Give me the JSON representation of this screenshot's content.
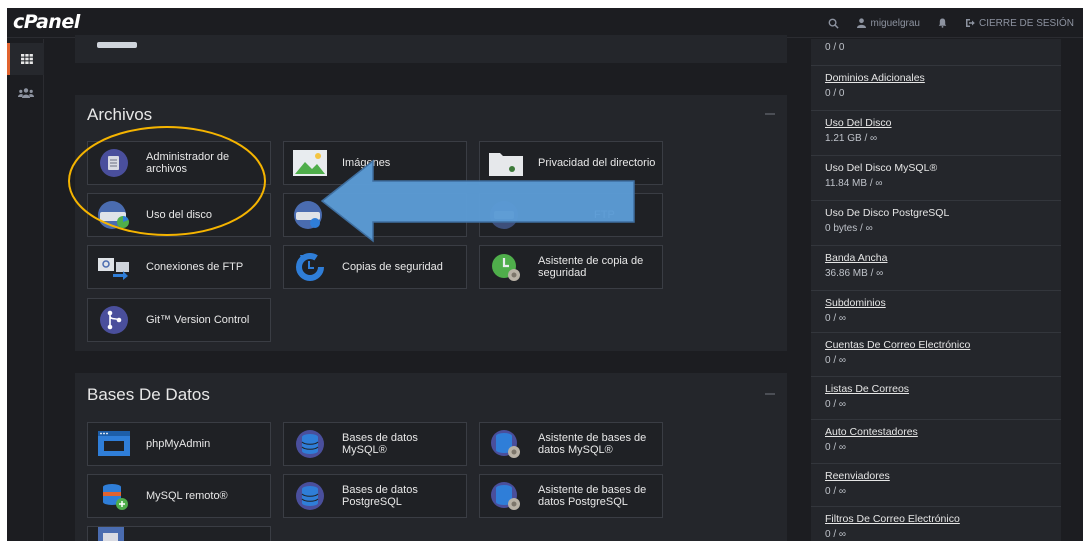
{
  "header": {
    "logo": "cPanel",
    "search_icon": "search-icon",
    "username": "miguelgrau",
    "bell_icon": "bell-icon",
    "logout_label": "CIERRE DE SESIÓN"
  },
  "leftnav": {
    "items": [
      {
        "name": "grid-icon",
        "active": true
      },
      {
        "name": "users-icon",
        "active": false
      }
    ]
  },
  "files_panel": {
    "title": "Archivos",
    "tiles": [
      {
        "label": "Administrador de archivos",
        "icon": "file-manager-icon"
      },
      {
        "label": "Imágenes",
        "icon": "images-icon"
      },
      {
        "label": "Privacidad del directorio",
        "icon": "folder-icon"
      },
      {
        "label": "Uso del disco",
        "icon": "disk-usage-icon"
      },
      {
        "label": "",
        "icon": "web-disk-icon"
      },
      {
        "label": "FTP",
        "icon": "ftp-accounts-icon"
      },
      {
        "label": "Conexiones de FTP",
        "icon": "ftp-connections-icon"
      },
      {
        "label": "Copias de seguridad",
        "icon": "backup-icon"
      },
      {
        "label": "Asistente de copia de seguridad",
        "icon": "backup-wizard-icon"
      },
      {
        "label": "Git™ Version Control",
        "icon": "git-icon"
      }
    ]
  },
  "db_panel": {
    "title": "Bases De Datos",
    "tiles": [
      {
        "label": "phpMyAdmin",
        "icon": "phpmyadmin-icon"
      },
      {
        "label": "Bases de datos MySQL®",
        "icon": "mysql-databases-icon"
      },
      {
        "label": "Asistente de bases de datos MySQL®",
        "icon": "mysql-wizard-icon"
      },
      {
        "label": "MySQL remoto®",
        "icon": "remote-mysql-icon"
      },
      {
        "label": "Bases de datos PostgreSQL",
        "icon": "postgresql-databases-icon"
      },
      {
        "label": "Asistente de bases de datos PostgreSQL",
        "icon": "postgresql-wizard-icon"
      }
    ]
  },
  "stats": [
    {
      "name": "",
      "value": "0 / 0",
      "link": false
    },
    {
      "name": "Dominios Adicionales",
      "value": "0 / 0",
      "link": true
    },
    {
      "name": "Uso Del Disco",
      "value": "1.21 GB / ∞",
      "link": true
    },
    {
      "name": "Uso Del Disco MySQL®",
      "value": "11.84 MB / ∞",
      "link": false
    },
    {
      "name": "Uso De Disco PostgreSQL",
      "value": "0 bytes / ∞",
      "link": false
    },
    {
      "name": "Banda Ancha",
      "value": "36.86 MB / ∞",
      "link": true
    },
    {
      "name": "Subdominios",
      "value": "0 / ∞",
      "link": true
    },
    {
      "name": "Cuentas De Correo Electrónico",
      "value": "0 / ∞",
      "link": true
    },
    {
      "name": "Listas De Correos",
      "value": "0 / ∞",
      "link": true
    },
    {
      "name": "Auto Contestadores",
      "value": "0 / ∞",
      "link": true
    },
    {
      "name": "Reenviadores",
      "value": "0 / ∞",
      "link": true
    },
    {
      "name": "Filtros De Correo Electrónico",
      "value": "0 / ∞",
      "link": true
    }
  ],
  "annotations": {
    "highlight": "yellow-ellipse",
    "arrow": "blue-arrow-pointing-left"
  },
  "colors": {
    "accent": "#e1632f",
    "highlight": "#f5b400",
    "arrow": "#5b9bd5",
    "background": "#1c1d21",
    "panel": "#24262b"
  }
}
